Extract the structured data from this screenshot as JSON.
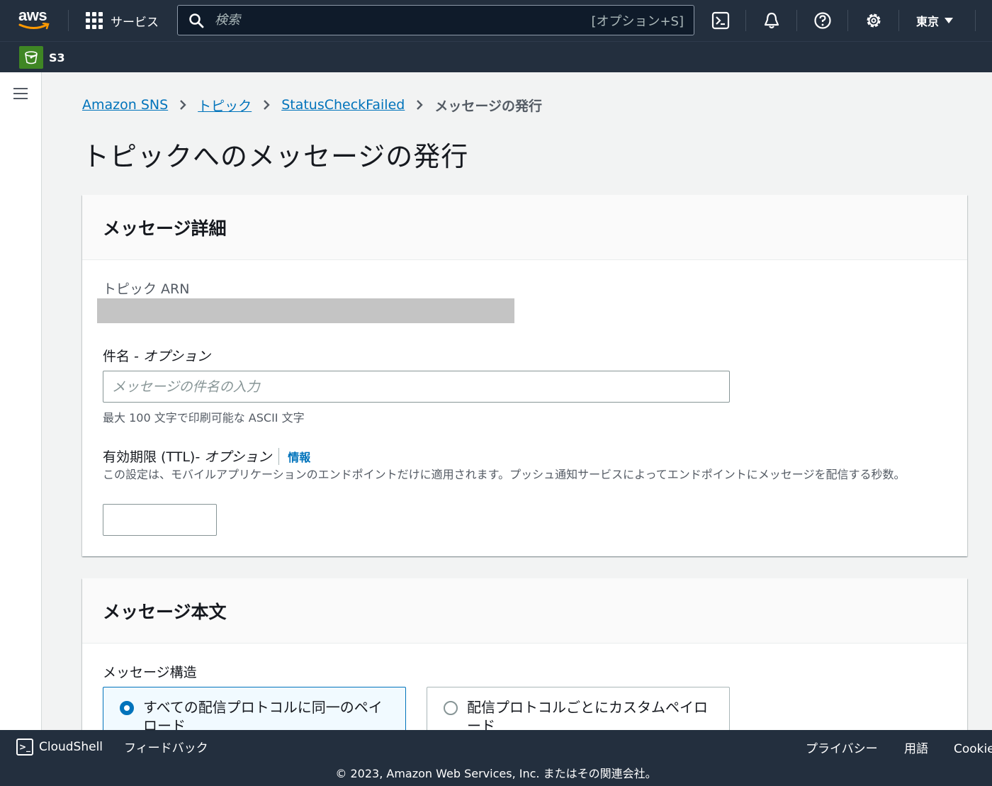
{
  "topnav": {
    "logo_text": "aws",
    "services_label": "サービス",
    "search_placeholder": "検索",
    "search_shortcut": "[オプション+S]",
    "region": "東京"
  },
  "favorites": {
    "s3_label": "S3"
  },
  "breadcrumb": {
    "items": [
      "Amazon SNS",
      "トピック",
      "StatusCheckFailed"
    ],
    "current": "メッセージの発行"
  },
  "page_title": "トピックへのメッセージの発行",
  "details_panel": {
    "heading": "メッセージ詳細",
    "topic_arn_label": "トピック ARN",
    "subject_label": "件名",
    "subject_optional": " - オプション",
    "subject_placeholder": "メッセージの件名の入力",
    "subject_hint": "最大 100 文字で印刷可能な ASCII 文字",
    "ttl_label": "有効期限 (TTL)",
    "ttl_optional": " - オプション",
    "ttl_info": "情報",
    "ttl_description": "この設定は、モバイルアプリケーションのエンドポイントだけに適用されます。プッシュ通知サービスによってエンドポイントにメッセージを配信する秒数。",
    "ttl_value": ""
  },
  "body_panel": {
    "heading": "メッセージ本文",
    "structure_label": "メッセージ構造",
    "option_identical": "すべての配信プロトコルに同一のペイロード",
    "option_custom": "配信プロトコルごとにカスタムペイロード"
  },
  "footer": {
    "cloudshell": "CloudShell",
    "feedback": "フィードバック",
    "privacy": "プライバシー",
    "terms": "用語",
    "cookie": "Cookie の設定",
    "copyright": "© 2023, Amazon Web Services, Inc. またはその関連会社。"
  },
  "colors": {
    "nav_bg": "#232f3e",
    "link": "#0073bb",
    "s3_green": "#3f8624",
    "page_bg": "#f2f3f3"
  }
}
